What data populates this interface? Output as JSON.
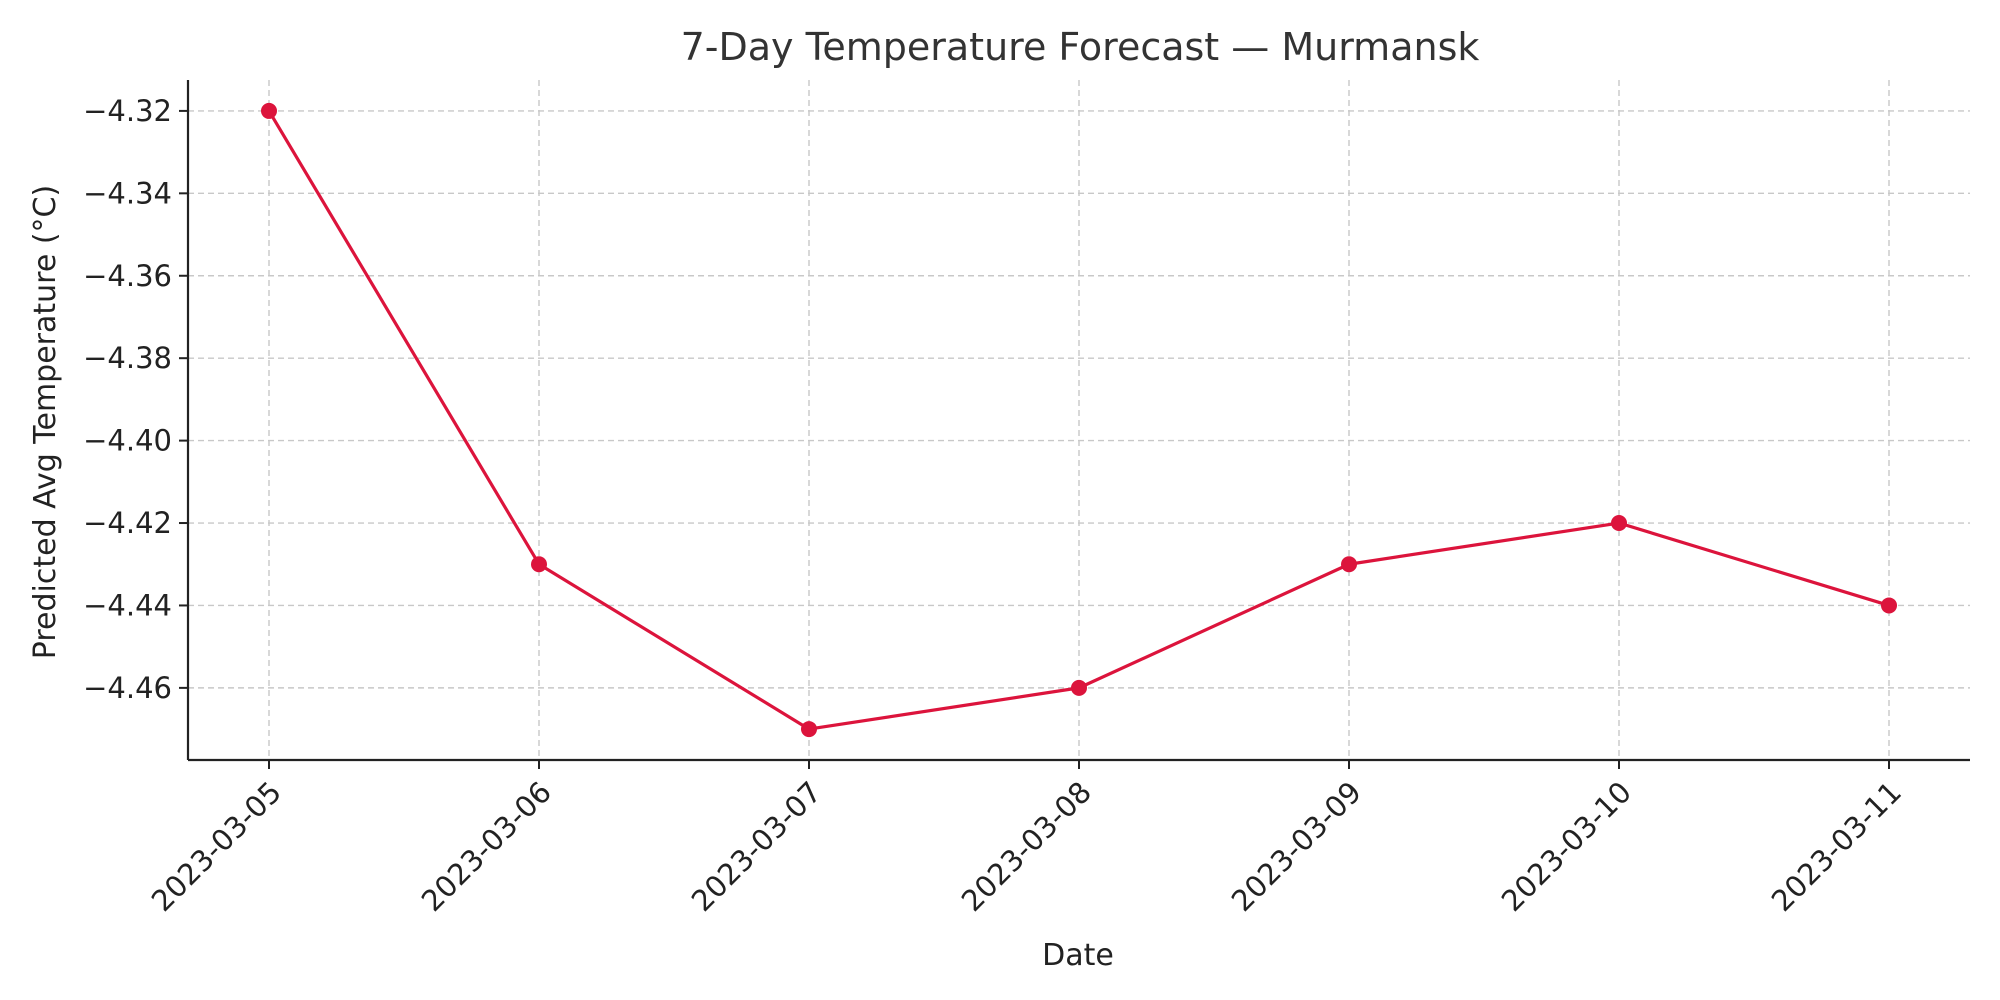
{
  "chart_data": {
    "type": "line",
    "title": "7-Day Temperature Forecast — Murmansk",
    "xlabel": "Date",
    "ylabel": "Predicted Avg Temperature (°C)",
    "categories": [
      "2023-03-05",
      "2023-03-06",
      "2023-03-07",
      "2023-03-08",
      "2023-03-09",
      "2023-03-10",
      "2023-03-11"
    ],
    "series": [
      {
        "values": [
          -4.32,
          -4.43,
          -4.47,
          -4.46,
          -4.43,
          -4.42,
          -4.44
        ],
        "color": "#dc143c",
        "marker": "circle"
      }
    ],
    "ylim": [
      -4.4775,
      -4.3125
    ],
    "yticks": [
      -4.32,
      -4.34,
      -4.36,
      -4.38,
      -4.4,
      -4.42,
      -4.44,
      -4.46
    ],
    "ytick_labels": [
      "−4.32",
      "−4.34",
      "−4.36",
      "−4.38",
      "−4.40",
      "−4.42",
      "−4.44",
      "−4.46"
    ],
    "grid": true,
    "legend": "none"
  }
}
